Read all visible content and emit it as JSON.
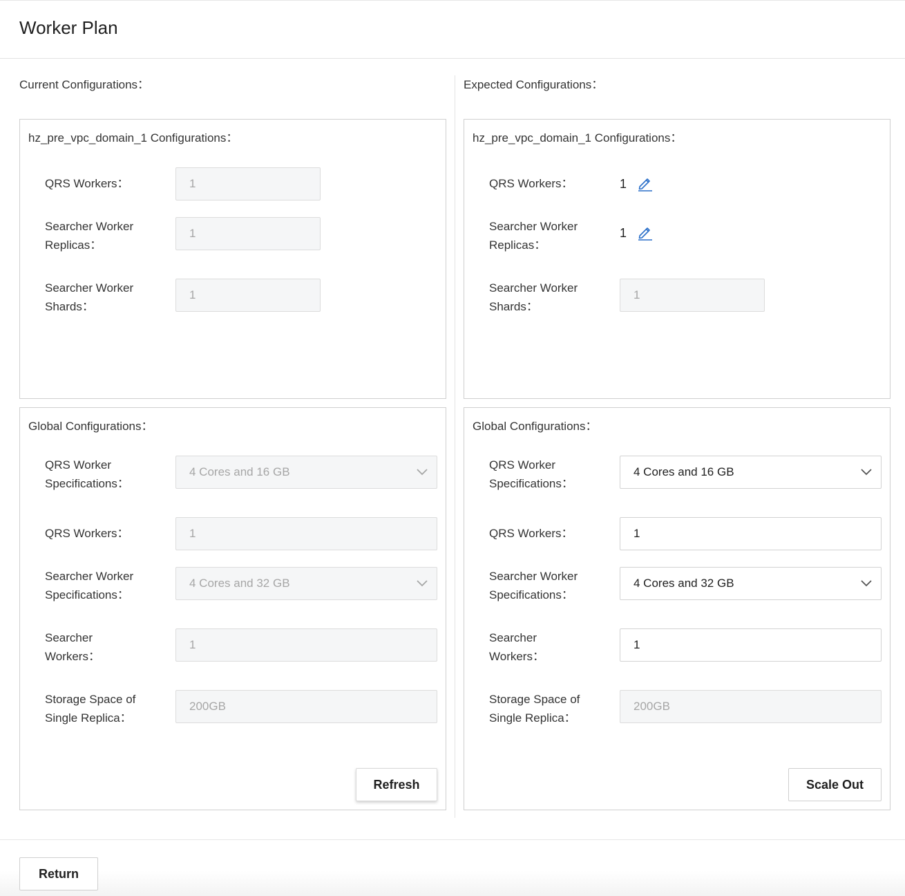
{
  "page": {
    "title": "Worker Plan"
  },
  "current": {
    "title": "Current Configurations：",
    "domain": {
      "title": "hz_pre_vpc_domain_1 Configurations：",
      "qrs_workers_label": "QRS Workers：",
      "qrs_workers_value": "1",
      "replicas_label": "Searcher Worker Replicas：",
      "replicas_value": "1",
      "shards_label": "Searcher Worker Shards：",
      "shards_value": "1"
    },
    "global": {
      "title": "Global Configurations：",
      "qrs_spec_label": "QRS Worker Specifications：",
      "qrs_spec_value": "4 Cores and 16 GB",
      "qrs_workers_label": "QRS Workers：",
      "qrs_workers_value": "1",
      "searcher_spec_label": "Searcher Worker Specifications：",
      "searcher_spec_value": "4 Cores and 32 GB",
      "searcher_workers_label": "Searcher Workers：",
      "searcher_workers_value": "1",
      "storage_label": "Storage Space of Single Replica：",
      "storage_value": "200GB",
      "refresh_label": "Refresh"
    }
  },
  "expected": {
    "title": "Expected Configurations：",
    "domain": {
      "title": "hz_pre_vpc_domain_1 Configurations：",
      "qrs_workers_label": "QRS Workers：",
      "qrs_workers_value": "1",
      "replicas_label": "Searcher Worker Replicas：",
      "replicas_value": "1",
      "shards_label": "Searcher Worker Shards：",
      "shards_value": "1"
    },
    "global": {
      "title": "Global Configurations：",
      "qrs_spec_label": "QRS Worker Specifications：",
      "qrs_spec_value": "4 Cores and 16 GB",
      "qrs_workers_label": "QRS Workers：",
      "qrs_workers_value": "1",
      "searcher_spec_label": "Searcher Worker Specifications：",
      "searcher_spec_value": "4 Cores and 32 GB",
      "searcher_workers_label": "Searcher Workers：",
      "searcher_workers_value": "1",
      "storage_label": "Storage Space of Single Replica：",
      "storage_value": "200GB",
      "scale_out_label": "Scale Out"
    }
  },
  "footer": {
    "return_label": "Return"
  },
  "icons": {
    "edit": "pencil-edit-icon",
    "dropdown": "chevron-down-icon"
  },
  "colors": {
    "link_blue": "#2a6fc9",
    "disabled_bg": "#f5f6f7",
    "disabled_text": "#a6a6a6"
  }
}
